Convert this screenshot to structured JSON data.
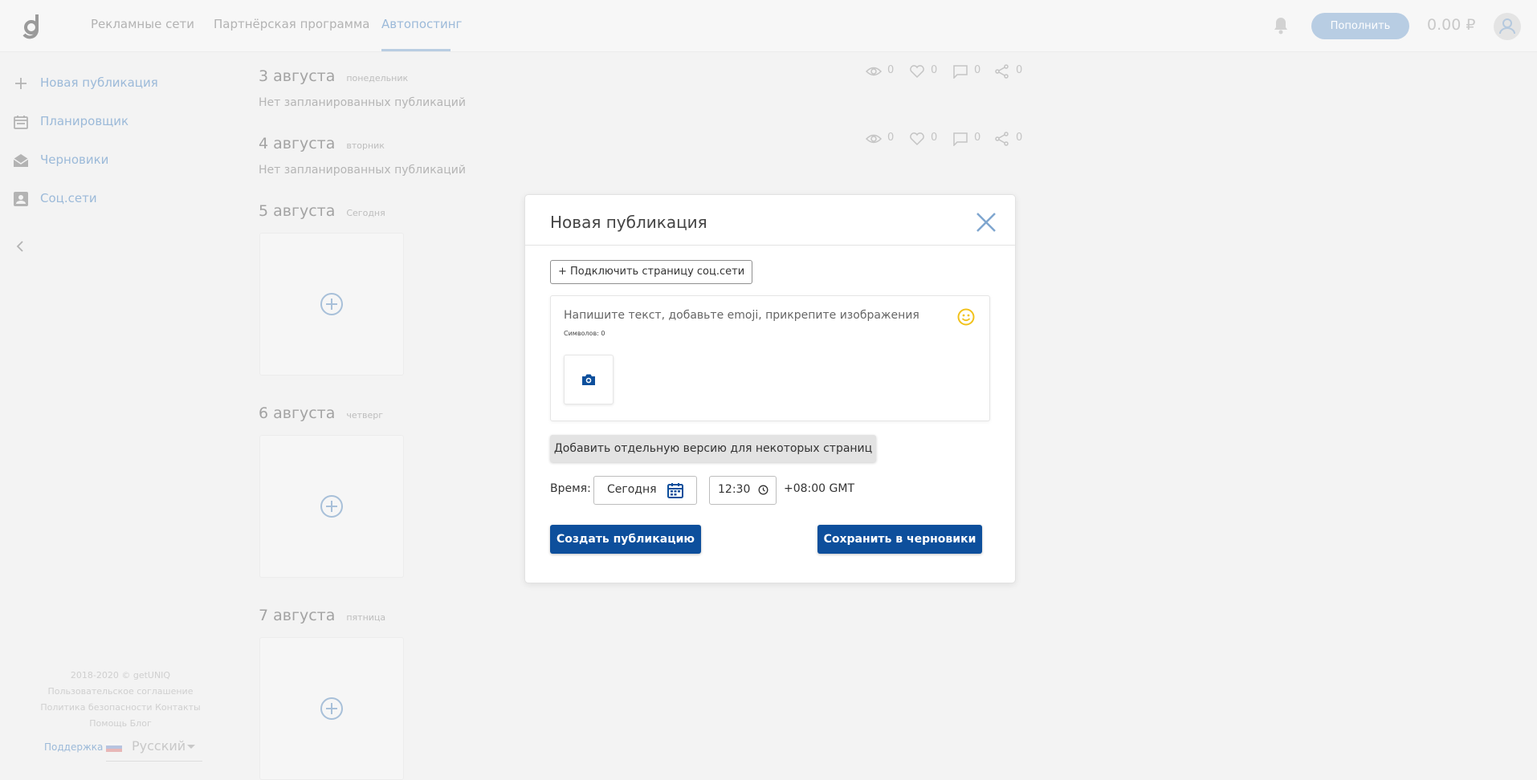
{
  "header": {
    "nav": [
      "Рекламные сети",
      "Партнёрская программа",
      "Автопостинг"
    ],
    "active_nav": "Автопостинг",
    "topup_label": "Пополнить",
    "balance": "0.00 ₽"
  },
  "sidebar": {
    "items": [
      {
        "label": "Новая публикация",
        "icon": "plus-icon"
      },
      {
        "label": "Планировщик",
        "icon": "calendar-icon"
      },
      {
        "label": "Черновики",
        "icon": "drafts-icon"
      },
      {
        "label": "Соц.сети",
        "icon": "account-box-icon"
      }
    ],
    "footer": {
      "copyright": "2018-2020 © getUNIQ",
      "links_row1": "Пользовательское соглашение",
      "links_row2": "Политика безопасности  Контакты",
      "links_row3": "Помощь  Блог",
      "support": "Поддержка",
      "language": "Русский"
    }
  },
  "days": [
    {
      "date": "3 августа",
      "weekday": "понедельник",
      "empty": "Нет запланированных публикаций",
      "views": "0",
      "likes": "0",
      "comments": "0",
      "shares": "0"
    },
    {
      "date": "4 августа",
      "weekday": "вторник",
      "empty": "Нет запланированных публикаций",
      "views": "0",
      "likes": "0",
      "comments": "0",
      "shares": "0"
    },
    {
      "date": "5 августа",
      "weekday": "Сегодня"
    },
    {
      "date": "6 августа",
      "weekday": "четверг"
    },
    {
      "date": "7 августа",
      "weekday": "пятница"
    }
  ],
  "modal": {
    "title": "Новая публикация",
    "connect_label": "+ Подключить страницу соц.сети",
    "editor_placeholder": "Напишите текст, добавьте emoji, прикрепите изображения",
    "char_count": "Символов: 0",
    "version_label": "Добавить отдельную версию для некоторых страниц",
    "time_label": "Время:",
    "date_value": "Сегодня",
    "time_value": "12:30",
    "timezone": "+08:00 GMT",
    "create_label": "Создать публикацию",
    "draft_label": "Сохранить в черновики"
  },
  "colors": {
    "primary": "#0d4f9c",
    "nav_active": "#9cbad9",
    "emoji": "#f2c21b"
  }
}
